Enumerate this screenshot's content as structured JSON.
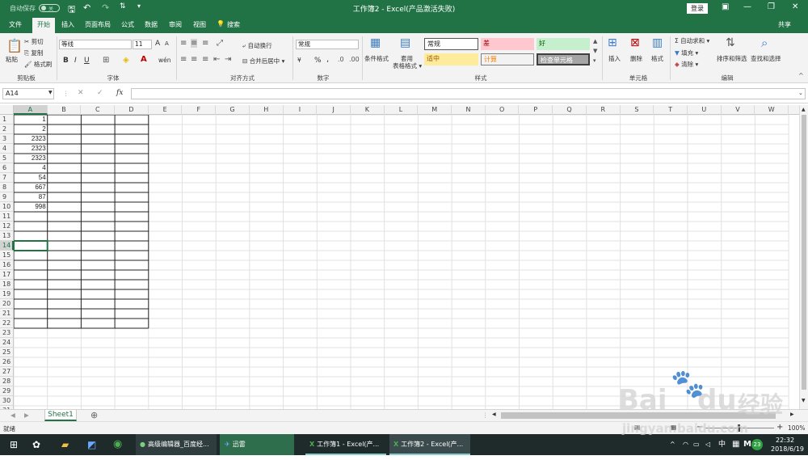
{
  "titlebar": {
    "autosave": "自动保存",
    "autosave_state": "关",
    "title": "工作簿2 - Excel(产品激活失败)",
    "login": "登录",
    "min": "—",
    "restore": "❐",
    "close": "✕",
    "save_icon": "floppy-icon",
    "undo_icon": "undo-icon",
    "redo_icon": "redo-icon"
  },
  "tabs": {
    "file": "文件",
    "home": "开始",
    "insert": "插入",
    "layout": "页面布局",
    "formulas": "公式",
    "data": "数据",
    "review": "审阅",
    "view": "视图",
    "search": "搜索",
    "share": "共享"
  },
  "ribbon": {
    "clipboard": {
      "paste": "粘贴",
      "cut": "剪切",
      "copy": "复制",
      "painter": "格式刷",
      "label": "剪贴板"
    },
    "font": {
      "name": "等线",
      "size": "11",
      "bold": "B",
      "italic": "I",
      "underline": "U",
      "grow": "A",
      "shrink": "A",
      "phonetic": "wén",
      "label": "字体"
    },
    "align": {
      "wrap": "自动换行",
      "merge": "合并后居中",
      "label": "对齐方式"
    },
    "number": {
      "format": "常规",
      "currency": "¥",
      "percent": "%",
      "comma": ",",
      "label": "数字"
    },
    "styles": {
      "conditional": "条件格式",
      "table": "套用\n表格格式",
      "normal": "常规",
      "bad": "差",
      "good": "好",
      "neutral": "适中",
      "calc": "计算",
      "check": "检查单元格",
      "label": "样式"
    },
    "cells": {
      "insert": "插入",
      "delete": "删除",
      "format": "格式",
      "label": "单元格"
    },
    "editing": {
      "autosum": "自动求和",
      "fill": "填充",
      "clear": "清除",
      "sort": "排序和筛选",
      "find": "查找和选择",
      "label": "编辑"
    }
  },
  "formula_bar": {
    "name_box": "A14",
    "cancel": "✕",
    "enter": "✓",
    "fx": "fx",
    "value": ""
  },
  "columns": [
    "A",
    "B",
    "C",
    "D",
    "E",
    "F",
    "G",
    "H",
    "I",
    "J",
    "K",
    "L",
    "M",
    "N",
    "O",
    "P",
    "Q",
    "R",
    "S",
    "T",
    "U",
    "V",
    "W"
  ],
  "rows": [
    "1",
    "2",
    "3",
    "4",
    "5",
    "6",
    "7",
    "8",
    "9",
    "10",
    "11",
    "12",
    "13",
    "14",
    "15",
    "16",
    "17",
    "18",
    "19",
    "20",
    "21",
    "22",
    "23",
    "24",
    "25",
    "26",
    "27",
    "28",
    "29",
    "30",
    "31"
  ],
  "cells_a": [
    "1",
    "2",
    "2323",
    "2323",
    "2323",
    "4",
    "54",
    "667",
    "87",
    "998"
  ],
  "selected_cell": "A14",
  "sheet_tabs": [
    "Sheet1"
  ],
  "status": {
    "ready": "就绪",
    "zoom": "100%"
  },
  "taskbar": {
    "items": [
      "高级编辑器_百度经...",
      "迅雷",
      "工作簿1 - Excel(产...",
      "工作簿2 - Excel(产..."
    ],
    "ime": "中",
    "time": "22:32",
    "date": "2018/6/19",
    "badge": "23",
    "m": "M"
  },
  "watermark": {
    "brand": "Bai",
    "brand2": "du",
    "cn": "经验",
    "url": "jingyan.baidu.com"
  },
  "colors": {
    "excel_green": "#217346"
  }
}
